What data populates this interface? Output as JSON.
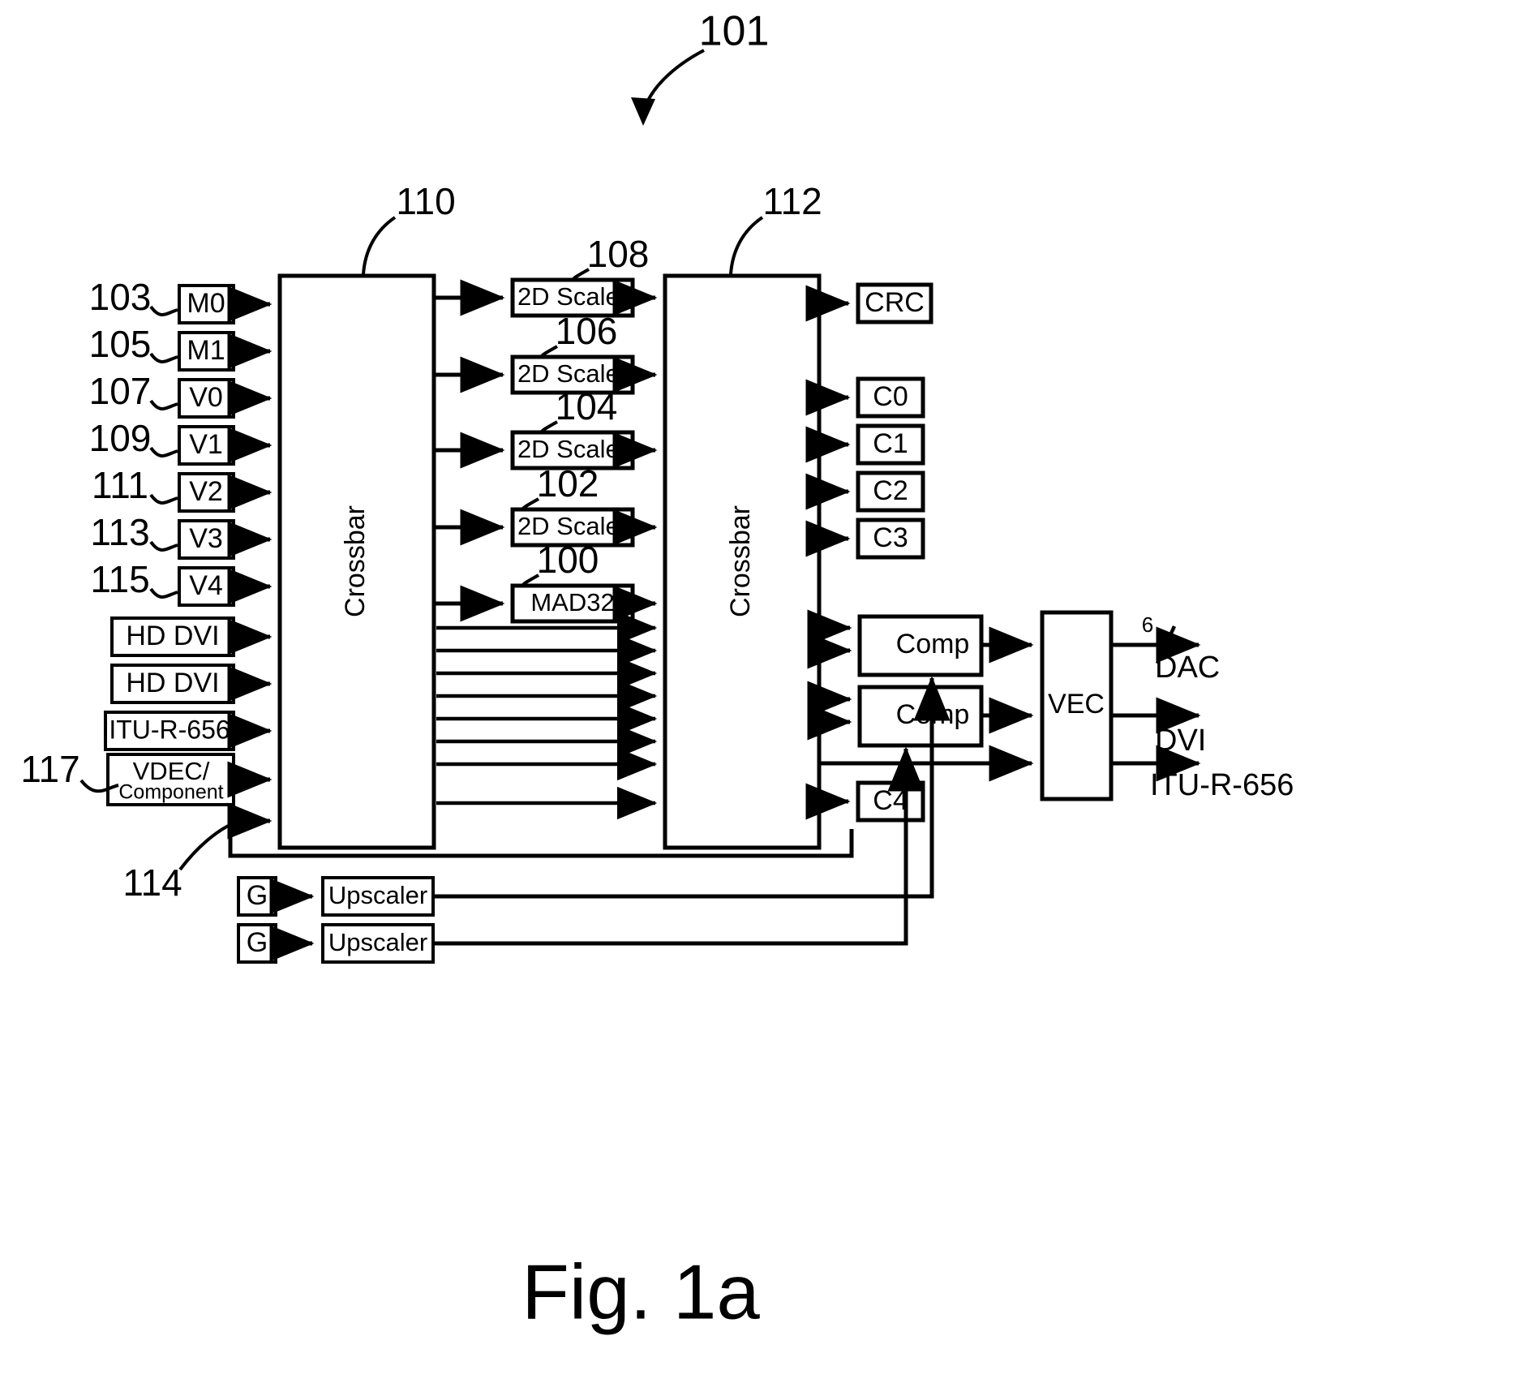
{
  "figure": {
    "caption": "Fig. 1a",
    "top_ref": "101"
  },
  "inputs": {
    "refs": [
      "103",
      "105",
      "107",
      "109",
      "111",
      "113",
      "115"
    ],
    "boxes": [
      {
        "label": "M0"
      },
      {
        "label": "M1"
      },
      {
        "label": "V0"
      },
      {
        "label": "V1"
      },
      {
        "label": "V2"
      },
      {
        "label": "V3"
      },
      {
        "label": "V4"
      }
    ],
    "wide_boxes": [
      {
        "label": "HD DVI"
      },
      {
        "label": "HD DVI"
      },
      {
        "label": "ITU-R-656"
      }
    ],
    "vdec": {
      "line1": "VDEC/",
      "line2": "Component",
      "ref": "117"
    },
    "feedback_ref": "114"
  },
  "crossbars": {
    "left": {
      "label": "Crossbar",
      "ref": "110"
    },
    "right": {
      "label": "Crossbar",
      "ref": "112"
    }
  },
  "processing": [
    {
      "label": "2D Scaler",
      "ref": "108"
    },
    {
      "label": "2D Scaler",
      "ref": "106"
    },
    {
      "label": "2D Scaler",
      "ref": "104"
    },
    {
      "label": "2D Scaler",
      "ref": "102"
    },
    {
      "label": "MAD32",
      "ref": "100"
    }
  ],
  "outputs": {
    "crc": {
      "label": "CRC"
    },
    "channels": [
      {
        "label": "C0"
      },
      {
        "label": "C1"
      },
      {
        "label": "C2"
      },
      {
        "label": "C3"
      }
    ],
    "c4": {
      "label": "C4"
    },
    "comps": [
      {
        "label": "Comp"
      },
      {
        "label": "Comp"
      }
    ],
    "vec": {
      "label": "VEC"
    },
    "terminals": [
      {
        "label": "DAC",
        "bus_width": "6"
      },
      {
        "label": "DVI"
      },
      {
        "label": "ITU-R-656"
      }
    ]
  },
  "graphics_path": [
    {
      "source": "G",
      "scaler": "Upscaler"
    },
    {
      "source": "G",
      "scaler": "Upscaler"
    }
  ]
}
